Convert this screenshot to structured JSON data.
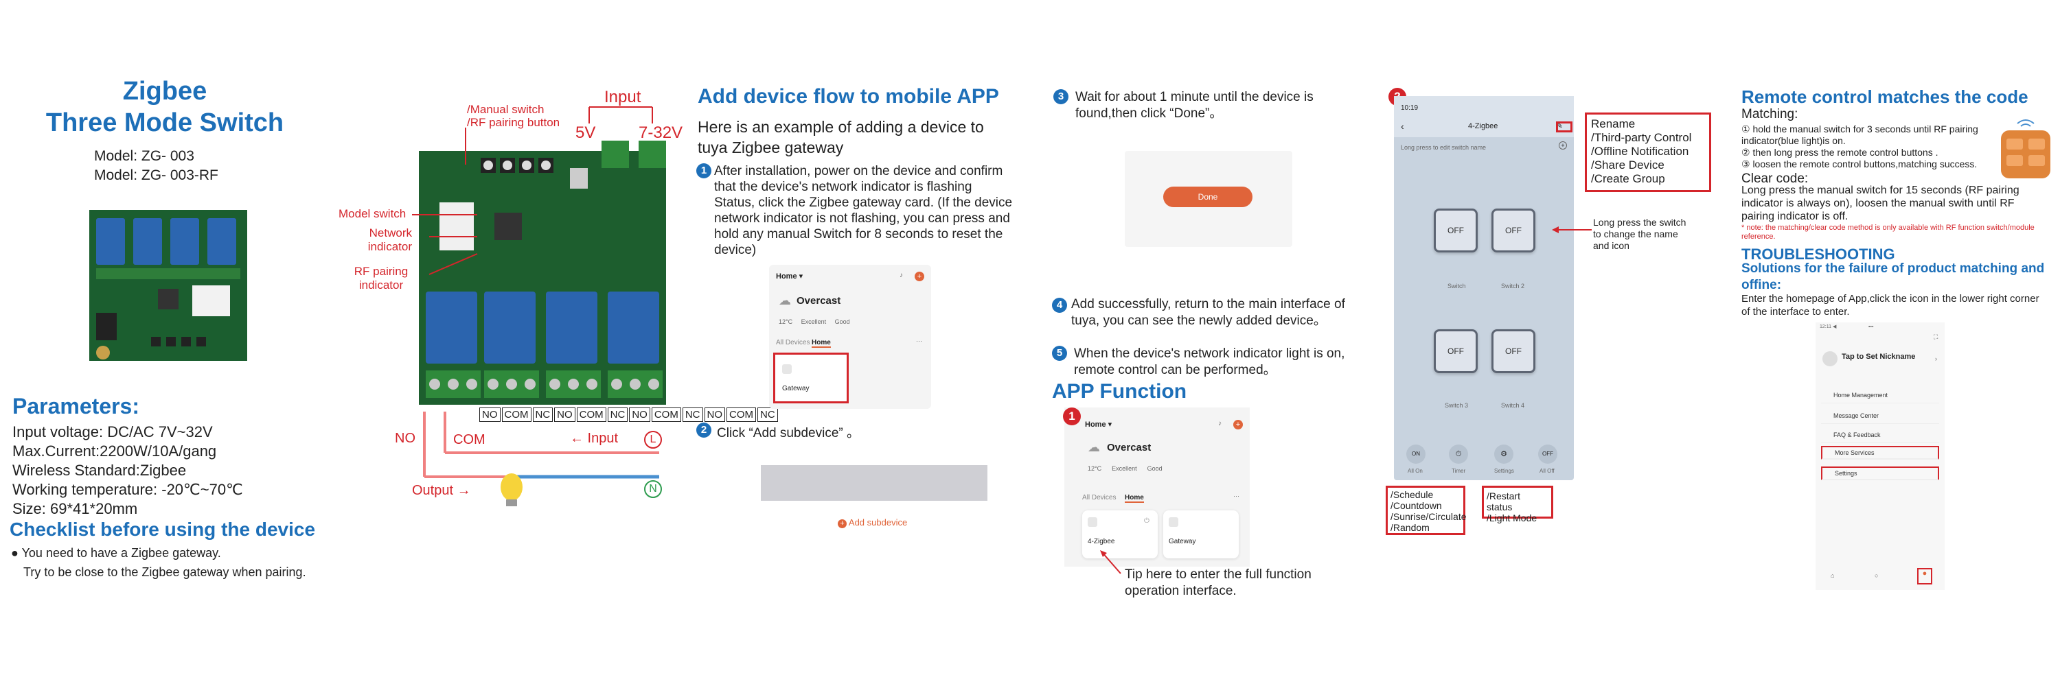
{
  "col1": {
    "title_line1": "Zigbee",
    "title_line2": "Three Mode Switch",
    "model1": "Model:  ZG- 003",
    "model2": "Model:  ZG- 003-RF",
    "params_title": "Parameters:",
    "params": [
      "Input voltage:  DC/AC 7V~32V",
      "Max.Current:2200W/10A/gang",
      "Wireless Standard:Zigbee",
      "Working temperature: -20℃~70℃",
      "Size: 69*41*20mm"
    ],
    "checklist_title": "Checklist before using the device",
    "checklist_1": "You need to have a Zigbee gateway.",
    "checklist_2": "Try to be close to the Zigbee gateway when pairing."
  },
  "col2": {
    "manual_switch": "/Manual switch",
    "rf_button": "/RF pairing button",
    "input": "Input",
    "v5": "5V",
    "v7_32": "7-32V",
    "model_switch": "Model switch",
    "network_indicator": "Network indicator",
    "rf_indicator": "RF pairing indicator",
    "terminals": [
      "NO",
      "COM",
      "NC",
      "NO",
      "COM",
      "NC",
      "NO",
      "COM",
      "NC",
      "NO",
      "COM",
      "NC"
    ],
    "no": "NO",
    "com": "COM",
    "input_arrow": "←  Input",
    "output": "Output  →",
    "l_symbol": "L",
    "n_symbol": "N"
  },
  "col3": {
    "title": "Add device flow to mobile APP",
    "intro": "Here is an example of adding a device to tuya Zigbee gateway",
    "step1": "After installation, power on the device and confirm that the device's network indicator is flashing Status, click the Zigbee gateway card. (If the device network indicator is not flashing, you can press and hold any manual Switch for 8 seconds to reset the device)",
    "step1_num": "1",
    "home": "Home",
    "overcast": "Overcast",
    "all_devices": "All Devices",
    "home_tab": "Home",
    "gateway": "Gateway",
    "step2_num": "2",
    "step2": "Click  “Add subdevice” 。",
    "add_subdevice": "Add subdevice"
  },
  "col4": {
    "step3_num": "3",
    "step3": "Wait for about 1 minute until the device is found,then click  “Done”。",
    "done": "Done",
    "step4_num": "4",
    "step4": "Add successfully, return to the main interface of tuya, you can see the newly added device。",
    "step5_num": "5",
    "step5": "When the device's network indicator light is on, remote control can be performed。",
    "app_function": "APP Function",
    "badge1": "1",
    "home": "Home",
    "overcast": "Overcast",
    "all_devices": "All Devices",
    "home_tab": "Home",
    "device1": "4-Zigbee",
    "device2": "Gateway",
    "tip": "Tip here to enter the full function operation interface."
  },
  "col5": {
    "badge2": "2",
    "time": "10:19",
    "screen_title": "4-Zigbee",
    "switches": [
      "Switch",
      "Switch 2",
      "Switch 3",
      "Switch 4"
    ],
    "off": "OFF",
    "rename_box": [
      "Rename",
      "/Third-party Control",
      "/Offline Notification",
      "/Share Device",
      "/Create Group"
    ],
    "long_press": "Long press the switch to change the name and icon",
    "bottom_labels": [
      "All On",
      "Timer",
      "Settings",
      "All Off"
    ],
    "schedule_box": [
      "/Schedule",
      "/Countdown",
      "/Sunrise/Circulate",
      "/Random"
    ],
    "restart_box": [
      "/Restart status",
      "/Light Mode"
    ]
  },
  "col6": {
    "title": "Remote control matches the code",
    "matching": "Matching:",
    "m1": "① hold the manual switch for 3 seconds until RF pairing indicator(blue light)is on.",
    "m2": "② then long press the remote control buttons .",
    "m3": "③ loosen the remote control buttons,matching success.",
    "clear": "Clear code:",
    "clear_text": "Long press the manual switch for 15 seconds (RF pairing indicator is always on), loosen the manual swith until RF pairing indicator is off.",
    "note": "* note: the matching/clear code method is only available with RF function switch/module reference.",
    "trouble": "TROUBLESHOOTING",
    "solutions": "Solutions for the failure of product matching and offine:",
    "enter": "Enter the homepage of App,click the icon in the lower right corner of the interface to enter.",
    "nickname": "Tap to Set Nickname",
    "menu": [
      "Home Management",
      "Message Center",
      "FAQ & Feedback",
      "More Services",
      "Settings"
    ]
  },
  "colors": {
    "accent": "#1d6fb8",
    "alert": "#d4252b",
    "button": "#e0643a"
  }
}
